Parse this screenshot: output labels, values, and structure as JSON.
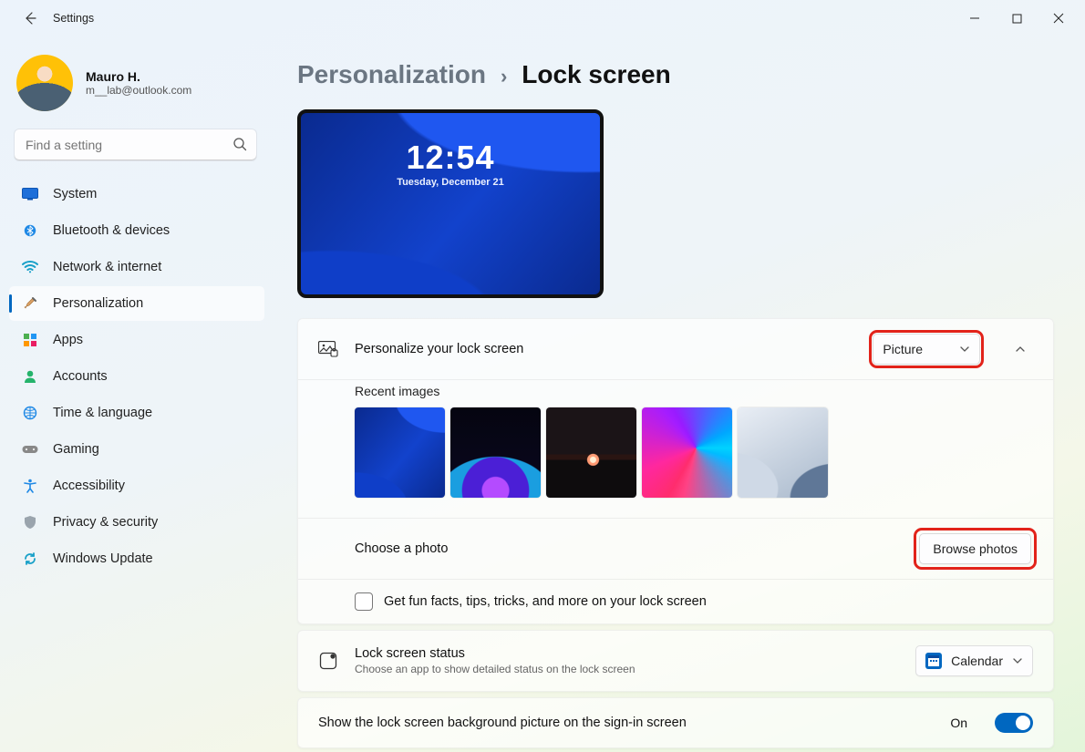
{
  "window": {
    "title": "Settings"
  },
  "profile": {
    "name": "Mauro H.",
    "email": "m__lab@outlook.com"
  },
  "search": {
    "placeholder": "Find a setting"
  },
  "nav": {
    "items": [
      {
        "label": "System"
      },
      {
        "label": "Bluetooth & devices"
      },
      {
        "label": "Network & internet"
      },
      {
        "label": "Personalization"
      },
      {
        "label": "Apps"
      },
      {
        "label": "Accounts"
      },
      {
        "label": "Time & language"
      },
      {
        "label": "Gaming"
      },
      {
        "label": "Accessibility"
      },
      {
        "label": "Privacy & security"
      },
      {
        "label": "Windows Update"
      }
    ],
    "active_index": 3
  },
  "breadcrumb": {
    "parent": "Personalization",
    "leaf": "Lock screen"
  },
  "preview": {
    "time": "12:54",
    "date": "Tuesday, December 21"
  },
  "personalize": {
    "label": "Personalize your lock screen",
    "dropdown_value": "Picture",
    "recent_label": "Recent images",
    "choose_label": "Choose a photo",
    "browse_label": "Browse photos",
    "fun_facts_label": "Get fun facts, tips, tricks, and more on your lock screen",
    "fun_facts_checked": false
  },
  "status": {
    "label": "Lock screen status",
    "sub": "Choose an app to show detailed status on the lock screen",
    "dropdown_value": "Calendar"
  },
  "signin": {
    "label": "Show the lock screen background picture on the sign-in screen",
    "state_label": "On",
    "value": true
  }
}
